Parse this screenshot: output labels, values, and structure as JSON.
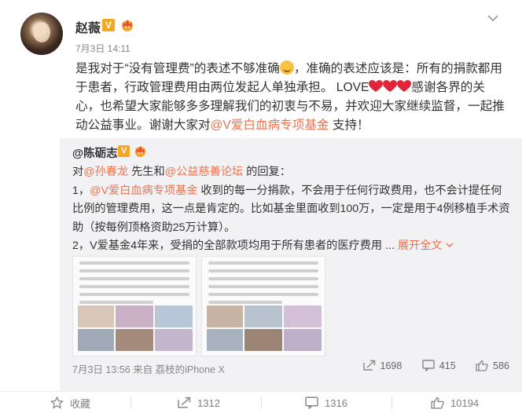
{
  "post": {
    "username": "赵薇",
    "verified_badge": "V",
    "timestamp": "7月3日 14:11",
    "text_part1": "是我对于“没有管理费”的表述不够准确",
    "text_part2": "，准确的表述应该是：所有的捐款都用于患者，行政管理费用由两位发起人单独承担。 LOVE",
    "text_part3": "感谢各界的关心，也希望大家能够多多理解我们的初衷与不易，并欢迎大家继续监督，一起推动公益事业。谢谢大家对",
    "mention_fund": "@V爱白血病专项基金",
    "text_part4": " 支持！",
    "icons": {
      "avatar": "avatar",
      "crown": "crown-badge-icon",
      "more": "chevron-down-icon",
      "emoji_smile": "smile-emoji",
      "heart": "red-heart-emoji"
    }
  },
  "repost": {
    "username": "@陈砺志",
    "verified_badge": "V",
    "line1_prefix": "对",
    "mention1": "@孙春龙",
    "line1_mid": " 先生和",
    "mention2": "@公益慈善论坛",
    "line1_suffix": " 的回复：",
    "para1_prefix": "1，",
    "para1_mention": "@V爱白血病专项基金",
    "para1_rest": " 收到的每一分捐款，不会用于任何行政费用，也不会计提任何比例的管理费用，这一点是肯定的。比如基金里面收到100万，一定是用于4例移植手术资助（按每例顶格资助25万计算）。",
    "para2": "2，V爱基金4年来，受捐的全部款项均用于所有患者的医疗费用 ...",
    "expand_label": "展开全文",
    "meta": "7月3日 13:56 来自 荔枝的iPhone X",
    "stats": {
      "repost_count": "1698",
      "comment_count": "415",
      "like_count": "586"
    }
  },
  "actions": {
    "favorite_label": "收藏",
    "repost_count": "1312",
    "comment_count": "1316",
    "like_count": "10194"
  },
  "colors": {
    "accent": "#eb7350",
    "badge": "#f5a623",
    "heart": "#e0243a",
    "muted": "#888888",
    "repost_bg": "#f2f2f5"
  }
}
